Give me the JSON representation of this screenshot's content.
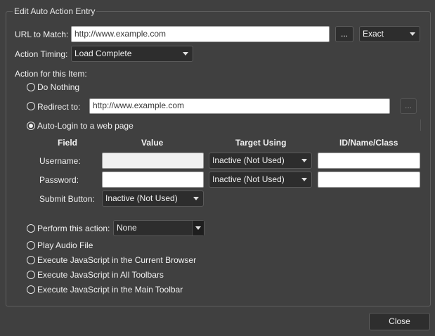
{
  "group": {
    "title": "Edit Auto Action Entry"
  },
  "url_match": {
    "label": "URL to Match:",
    "value": "http://www.example.com",
    "browse_label": "...",
    "match_mode": "Exact"
  },
  "timing": {
    "label": "Action Timing:",
    "value": "Load Complete"
  },
  "action_section": {
    "label": "Action for this Item:"
  },
  "options": {
    "do_nothing": "Do Nothing",
    "redirect": "Redirect to:",
    "redirect_value": "http://www.example.com",
    "redirect_browse": "...",
    "auto_login": "Auto-Login to a web page",
    "perform": "Perform this action:",
    "perform_value": "None",
    "play_audio": "Play Audio File",
    "js_current": "Execute JavaScript in the Current Browser",
    "js_all": "Execute JavaScript in All Toolbars",
    "js_main": "Execute JavaScript in the Main Toolbar"
  },
  "login_table": {
    "headers": {
      "field": "Field",
      "value": "Value",
      "target": "Target Using",
      "id": "ID/Name/Class"
    },
    "username_label": "Username:",
    "password_label": "Password:",
    "submit_label": "Submit Button:",
    "username_target": "Inactive (Not Used)",
    "password_target": "Inactive (Not Used)",
    "submit_value": "Inactive (Not Used)"
  },
  "footer": {
    "close_label": "Close"
  },
  "colors": {
    "background": "#404040",
    "field_bg": "#ffffff",
    "combo_bg": "#2d2d2d"
  }
}
